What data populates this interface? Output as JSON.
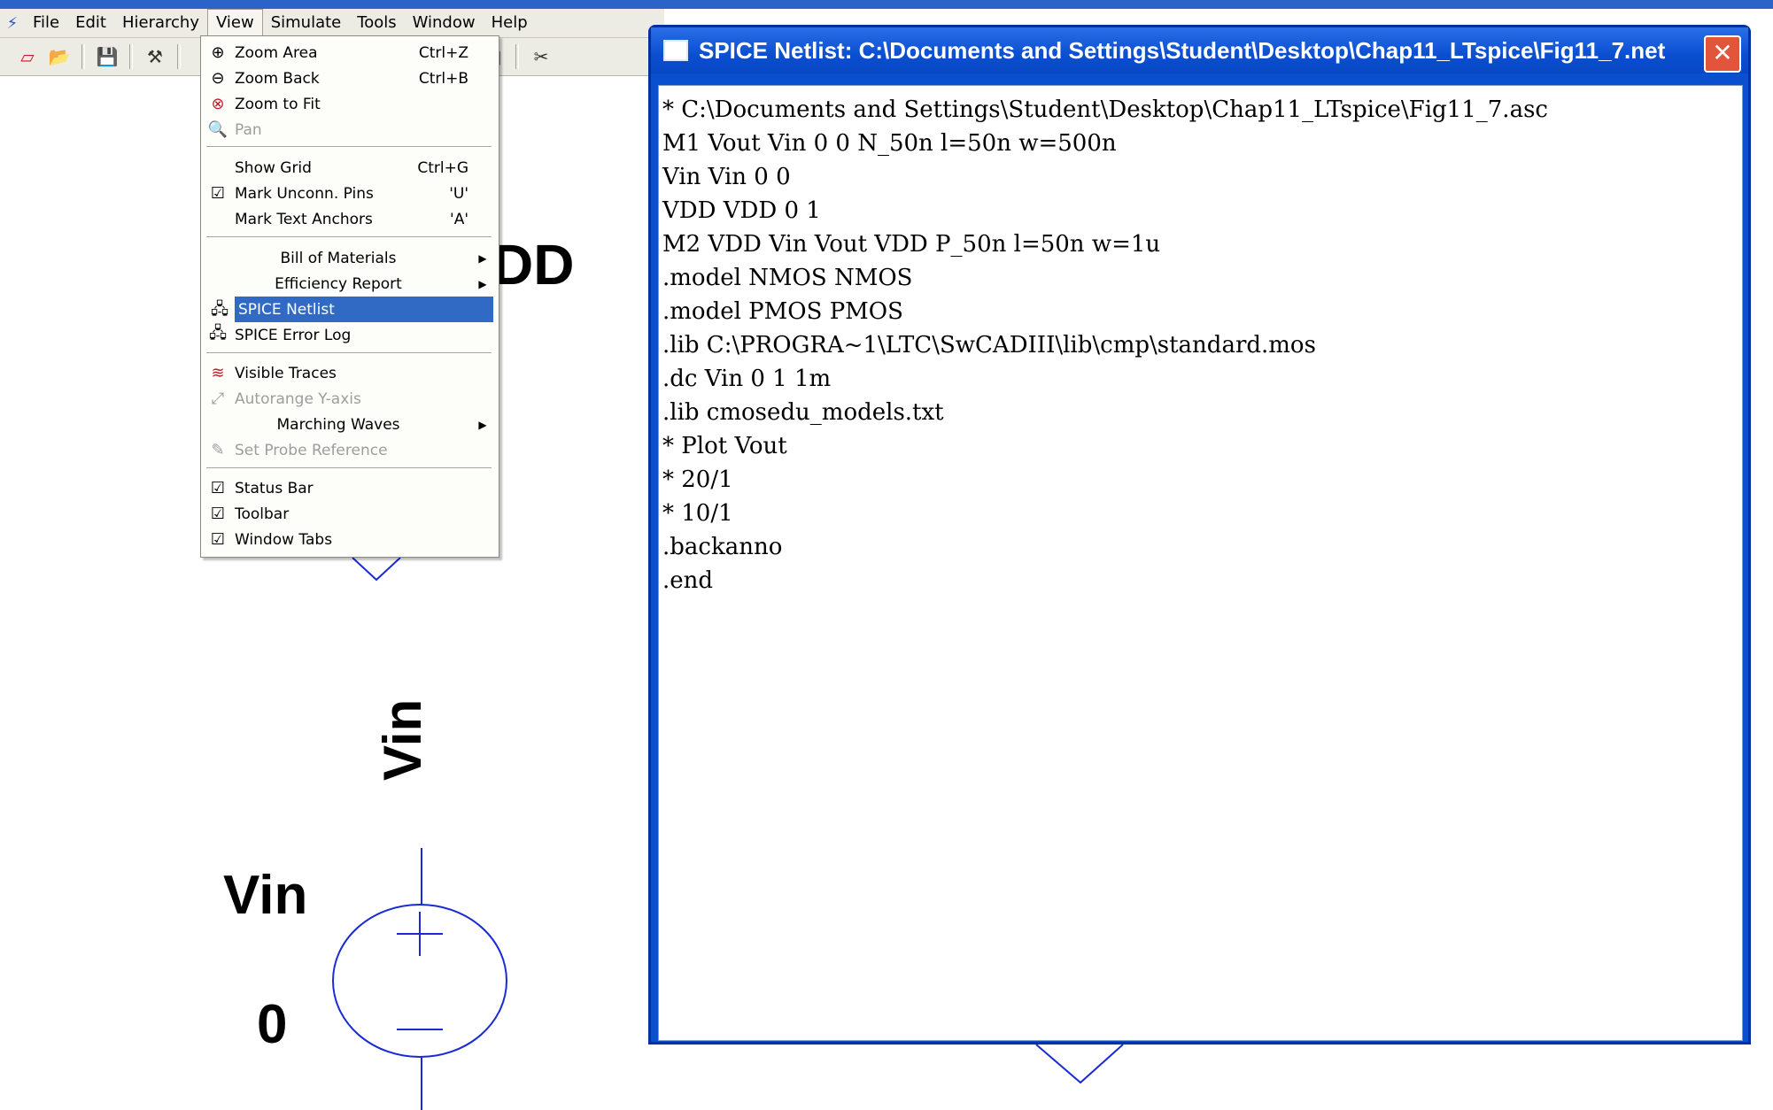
{
  "app": {
    "menubar": [
      "File",
      "Edit",
      "Hierarchy",
      "View",
      "Simulate",
      "Tools",
      "Window",
      "Help"
    ],
    "active_menu": "View",
    "toolbar_icons": [
      "new-schematic-icon",
      "open-icon",
      "save-icon",
      "control-panel-icon",
      "hierarchy-icon",
      "tile-horizontal-icon",
      "cascade-icon",
      "arrange-icons-icon",
      "cut-icon"
    ]
  },
  "view_menu": {
    "items": [
      {
        "label": "Zoom Area",
        "shortcut": "Ctrl+Z",
        "icon": "zoom-in-icon"
      },
      {
        "label": "Zoom Back",
        "shortcut": "Ctrl+B",
        "icon": "zoom-out-icon"
      },
      {
        "label": "Zoom to Fit",
        "shortcut": "",
        "icon": "zoom-fit-icon"
      },
      {
        "label": "Pan",
        "shortcut": "",
        "icon": "pan-icon",
        "disabled": true
      },
      {
        "label": "Show Grid",
        "shortcut": "Ctrl+G"
      },
      {
        "label": "Mark Unconn. Pins",
        "shortcut": "'U'",
        "checked": true
      },
      {
        "label": "Mark Text Anchors",
        "shortcut": "'A'"
      },
      {
        "label": "Bill of Materials",
        "submenu": true
      },
      {
        "label": "Efficiency Report",
        "submenu": true
      },
      {
        "label": "SPICE Netlist",
        "icon": "netlist-icon",
        "highlighted": true
      },
      {
        "label": "SPICE Error Log",
        "icon": "error-log-icon"
      },
      {
        "label": "Visible Traces",
        "icon": "traces-icon"
      },
      {
        "label": "Autorange Y-axis",
        "icon": "autorange-icon",
        "disabled": true
      },
      {
        "label": "Marching Waves",
        "submenu": true
      },
      {
        "label": "Set Probe Reference",
        "icon": "probe-icon",
        "disabled": true
      },
      {
        "label": "Status Bar",
        "checked": true
      },
      {
        "label": "Toolbar",
        "checked": true
      },
      {
        "label": "Window Tabs",
        "checked": true
      }
    ]
  },
  "netlist_window": {
    "title": "SPICE Netlist: C:\\Documents and Settings\\Student\\Desktop\\Chap11_LTspice\\Fig11_7.net",
    "lines": [
      "* C:\\Documents and Settings\\Student\\Desktop\\Chap11_LTspice\\Fig11_7.asc",
      "M1 Vout Vin 0 0 N_50n l=50n w=500n",
      "Vin Vin 0 0",
      "VDD VDD 0 1",
      "M2 VDD Vin Vout VDD P_50n l=50n w=1u",
      ".model NMOS NMOS",
      ".model PMOS PMOS",
      ".lib C:\\PROGRA~1\\LTC\\SwCADIII\\lib\\cmp\\standard.mos",
      ".dc Vin 0 1 1m",
      ".lib cmosedu_models.txt",
      "* Plot Vout",
      "* 20/1",
      "* 10/1",
      ".backanno",
      ".end"
    ]
  },
  "schematic": {
    "vdd_label_fragment": "DD",
    "net_label_vertical": "Vin",
    "source_name": "Vin",
    "source_value": "0"
  },
  "colors": {
    "title_bar": "#0a4fd0",
    "menu_highlight": "#316ac5",
    "schematic_wire": "#1a2bd6"
  }
}
